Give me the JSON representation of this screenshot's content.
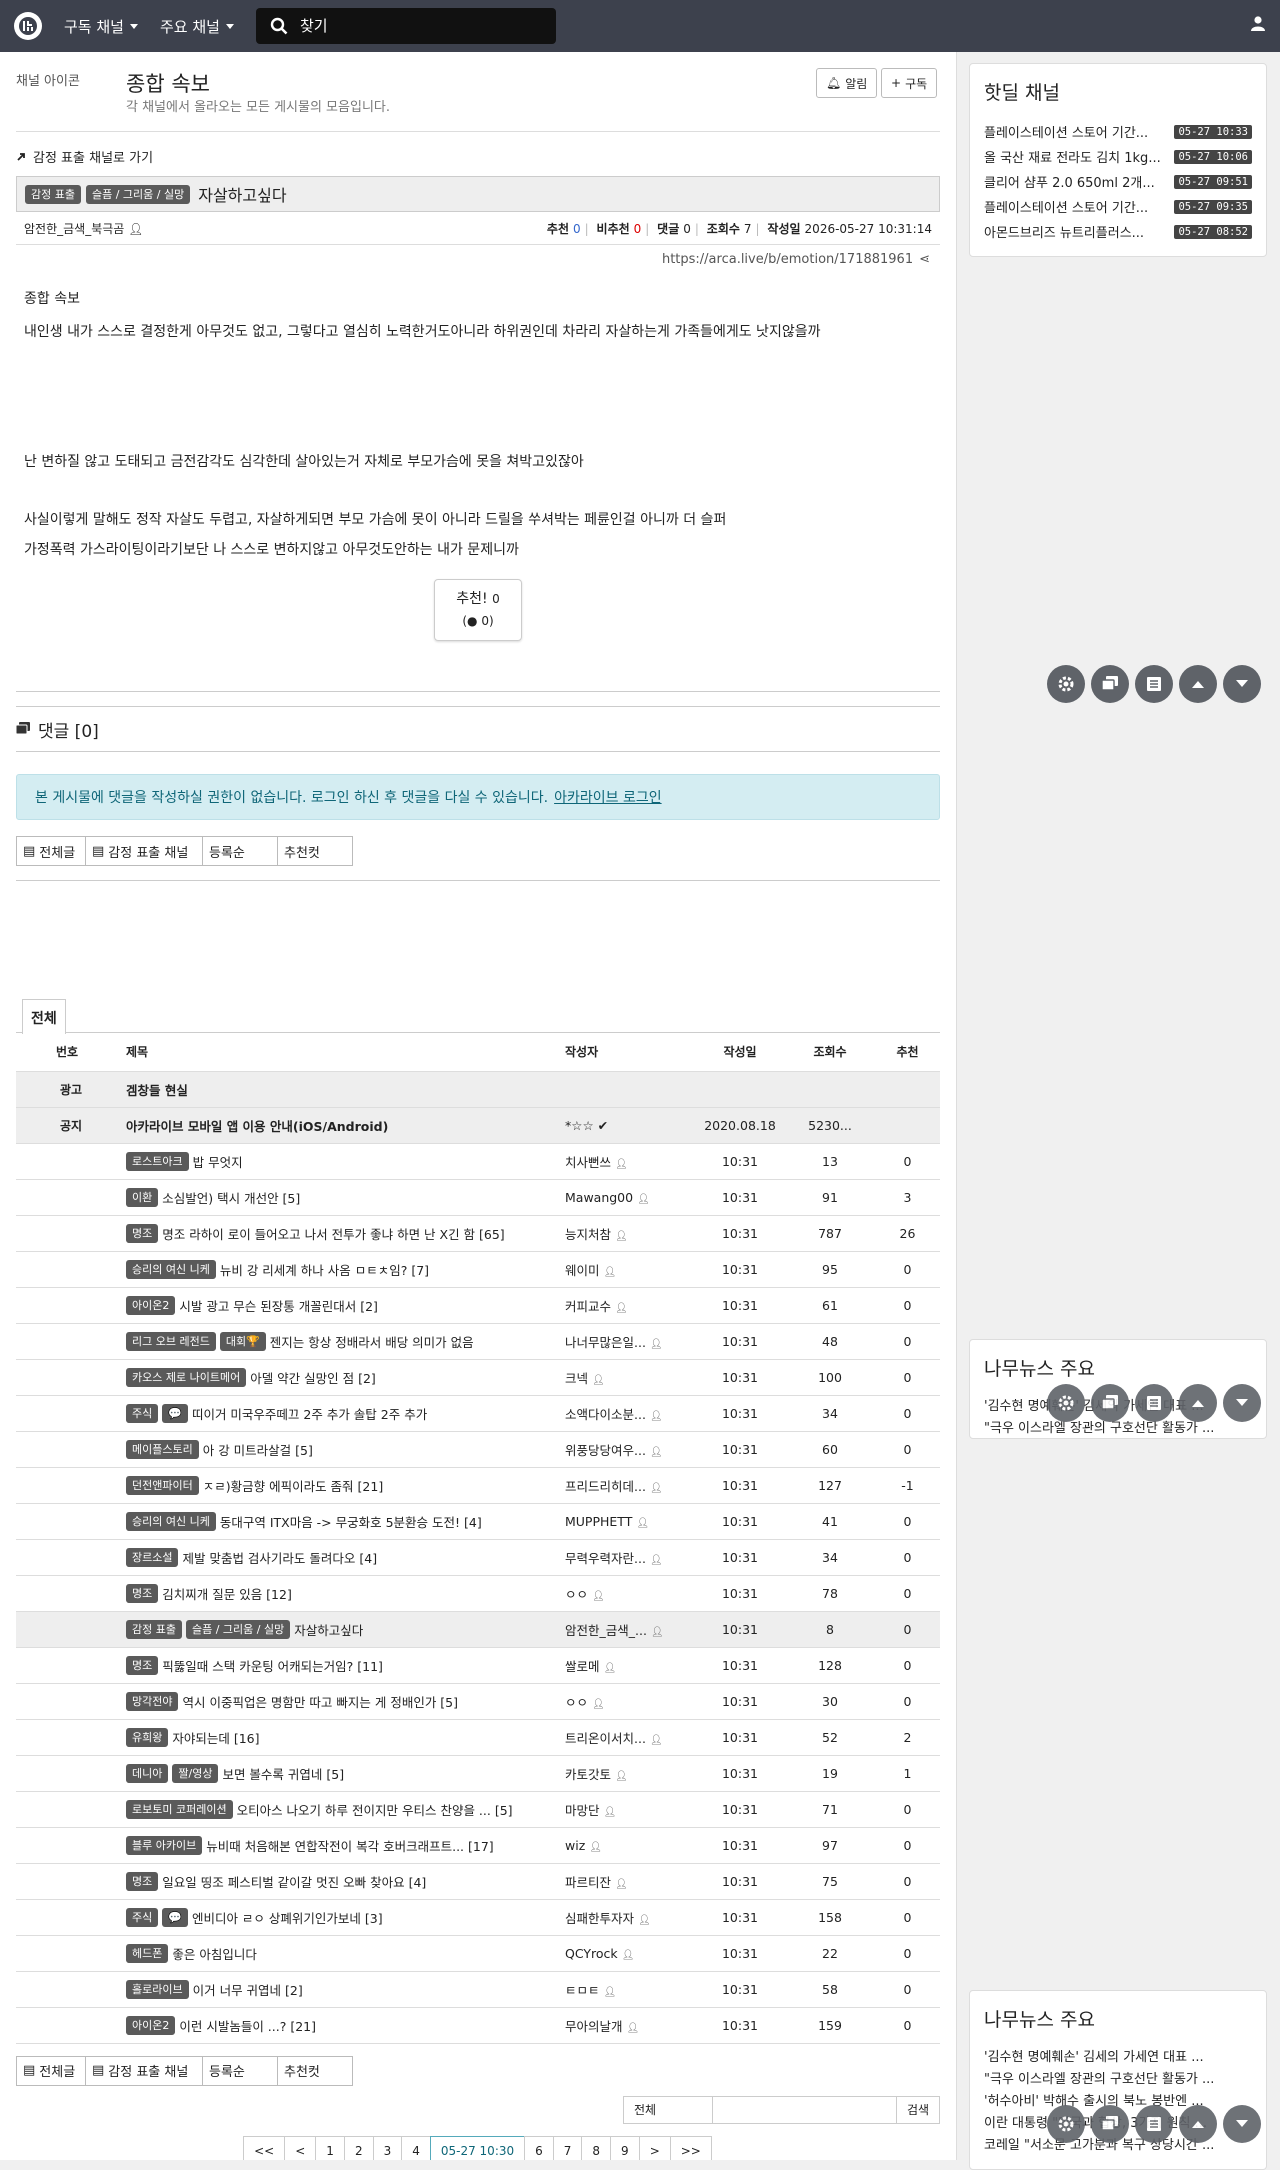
{
  "nav": {
    "menu1": "구독 채널",
    "menu2": "주요 채널",
    "search_placeholder": "찾기"
  },
  "channel": {
    "img_alt": "채널 아이콘",
    "title": "종합 속보",
    "desc": "각 채널에서 올라오는 모든 게시물의 모음입니다.",
    "alarm": "알림",
    "subscribe": "구독"
  },
  "article": {
    "goto": "감정 표출 채널로 가기",
    "badge1": "감정 표출",
    "badge2": "슬픔 / 그리움 / 실망",
    "title": "자살하고싶다",
    "author": "암전한_금색_북극곰",
    "rec_label": "추천",
    "rec": "0",
    "unrec_label": "비추천",
    "unrec": "0",
    "cmt_label": "댓글",
    "cmt": "0",
    "view_label": "조회수",
    "view": "7",
    "date_label": "작성일",
    "date": "2026-05-27 10:31:14",
    "url": "https://arca.live/b/emotion/171881961",
    "img_alt": "종합 속보",
    "p1": "내인생 내가 스스로 결정한게 아무것도 없고, 그렇다고 열심히 노력한거도아니라 하위권인데 차라리 자살하는게 가족들에게도 낫지않을까",
    "p2": "난 변하질 않고 도태되고 금전감각도 심각한데 살아있는거 자체로 부모가슴에 못을 쳐박고있잖아",
    "p3": "사실이렇게 말해도 정작 자살도 두렵고, 자살하게되면 부모 가슴에 못이 아니라 드릴을 쑤셔박는 페륜인걸 아니까 더 슬퍼",
    "p4": "가정폭력 가스라이팅이라기보단 나 스스로 변하지않고 아무것도안하는 내가 문제니까",
    "rec_btn": "추천!",
    "rec_btn_count": "0",
    "rec_btn_sub": "0"
  },
  "comments": {
    "title": "댓글 [0]",
    "alert": "본 게시물에 댓글을 작성하실 권한이 없습니다. 로그인 하신 후 댓글을 다실 수 있습니다.",
    "login_link": "아카라이브 로그인"
  },
  "tabs": [
    "전체글",
    "감정 표출 채널",
    "등록순",
    "추천컷"
  ],
  "list": {
    "tab": "전체",
    "headers": [
      "번호",
      "제목",
      "작성자",
      "작성일",
      "조회수",
      "추천"
    ],
    "ad": {
      "no": "광고",
      "title": "겜창들 현실"
    },
    "notice": {
      "no": "공지",
      "title": "아카라이브 모바일 앱 이용 안내(iOS/Android)",
      "author": "*☆☆",
      "date": "2020.08.18",
      "view": "5230..."
    },
    "rows": [
      {
        "b": [
          "로스트아크"
        ],
        "t": "밥 무엇지",
        "a": "치사뻔쓰",
        "d": "10:31",
        "v": "13",
        "r": "0"
      },
      {
        "b": [
          "이환"
        ],
        "t": "소심발언) 택시 개선안 [5]",
        "a": "Mawang00",
        "d": "10:31",
        "v": "91",
        "r": "3"
      },
      {
        "b": [
          "명조"
        ],
        "t": "명조 라하이 로이 들어오고 나서 전투가 좋냐 하면 난 X긴 함 [65]",
        "a": "능지처참",
        "d": "10:31",
        "v": "787",
        "r": "26"
      },
      {
        "b": [
          "승리의 여신 니케"
        ],
        "t": "뉴비 강 리세계 하나 사옴 ㅁㅌㅊ임? [7]",
        "a": "웨이미",
        "d": "10:31",
        "v": "95",
        "r": "0"
      },
      {
        "b": [
          "아이온2"
        ],
        "t": "시발 광고 무슨 된장통 개꼴린대서 [2]",
        "a": "커피교수",
        "d": "10:31",
        "v": "61",
        "r": "0"
      },
      {
        "b": [
          "리그 오브 레전드",
          "대회🏆"
        ],
        "t": "젠지는 항상 정배라서 배당 의미가 없음",
        "a": "나너무많은일...",
        "d": "10:31",
        "v": "48",
        "r": "0"
      },
      {
        "b": [
          "카오스 제로 나이트메어"
        ],
        "t": "아델 약간 실망인 점 [2]",
        "a": "크넥",
        "d": "10:31",
        "v": "100",
        "r": "0"
      },
      {
        "b": [
          "주식",
          "💬"
        ],
        "t": "띠이거 미국우주떼끄 2주 추가 솔탑 2주 추가",
        "a": "소액다이소분...",
        "d": "10:31",
        "v": "34",
        "r": "0"
      },
      {
        "b": [
          "메이플스토리"
        ],
        "t": "아 강 미트라살걸 [5]",
        "a": "위풍당당여우...",
        "d": "10:31",
        "v": "60",
        "r": "0"
      },
      {
        "b": [
          "던전앤파이터"
        ],
        "t": "ㅈㄹ)황금향 에픽이라도 좀줘 [21]",
        "a": "프리드리히데...",
        "d": "10:31",
        "v": "127",
        "r": "-1"
      },
      {
        "b": [
          "승리의 여신 니케"
        ],
        "t": "동대구역 ITX마음 -> 무궁화호 5분환승 도전! [4]",
        "a": "MUPPHETT",
        "d": "10:31",
        "v": "41",
        "r": "0"
      },
      {
        "b": [
          "장르소설"
        ],
        "t": "제발 맞춤법 검사기라도 돌려다오 [4]",
        "a": "무력우력자란...",
        "d": "10:31",
        "v": "34",
        "r": "0"
      },
      {
        "b": [
          "명조"
        ],
        "t": "김치찌개 질문 있음 [12]",
        "a": "ㅇㅇ",
        "d": "10:31",
        "v": "78",
        "r": "0"
      },
      {
        "b": [
          "감정 표출",
          "슬픔 / 그리움 / 실망"
        ],
        "t": "자살하고싶다",
        "a": "암전한_금색_...",
        "d": "10:31",
        "v": "8",
        "r": "0",
        "hl": true
      },
      {
        "b": [
          "명조"
        ],
        "t": "픽뚫일때 스택 카운팅 어캐되는거임? [11]",
        "a": "쌀로메",
        "d": "10:31",
        "v": "128",
        "r": "0"
      },
      {
        "b": [
          "망각전야"
        ],
        "t": "역시 이중픽업은 명함만 따고 빠지는 게 정배인가 [5]",
        "a": "ㅇㅇ",
        "d": "10:31",
        "v": "30",
        "r": "0"
      },
      {
        "b": [
          "유희왕"
        ],
        "t": "자야되는데 [16]",
        "a": "트리온이서치...",
        "d": "10:31",
        "v": "52",
        "r": "2"
      },
      {
        "b": [
          "데니아",
          "짤/영상"
        ],
        "t": "보면 볼수록 귀엽네 [5]",
        "a": "카토갓토",
        "d": "10:31",
        "v": "19",
        "r": "1"
      },
      {
        "b": [
          "로보토미 코퍼레이션"
        ],
        "t": "오티아스 나오기 하루 전이지만 우티스 찬양을 ... [5]",
        "a": "마망단",
        "d": "10:31",
        "v": "71",
        "r": "0"
      },
      {
        "b": [
          "블루 아카이브"
        ],
        "t": "뉴비때 처음해본 연합작전이 복각 호버크래프트... [17]",
        "a": "wiz",
        "d": "10:31",
        "v": "97",
        "r": "0"
      },
      {
        "b": [
          "명조"
        ],
        "t": "일요일 띵조 페스티벌 같이갈 멋진 오빠 찾아요 [4]",
        "a": "파르티잔",
        "d": "10:31",
        "v": "75",
        "r": "0"
      },
      {
        "b": [
          "주식",
          "💬"
        ],
        "t": "엔비디아 ㄹㅇ 상폐위기인가보네 [3]",
        "a": "심패한투자자",
        "d": "10:31",
        "v": "158",
        "r": "0"
      },
      {
        "b": [
          "헤드폰"
        ],
        "t": "좋은 아침입니다",
        "a": "QCYrock",
        "d": "10:31",
        "v": "22",
        "r": "0"
      },
      {
        "b": [
          "홀로라이브"
        ],
        "t": "이거 너무 귀엽네 [2]",
        "a": "ㅌㅁㅌ",
        "d": "10:31",
        "v": "58",
        "r": "0"
      },
      {
        "b": [
          "아이온2"
        ],
        "t": "이런 시발놈들이 ...? [21]",
        "a": "무아의날개",
        "d": "10:31",
        "v": "159",
        "r": "0"
      }
    ]
  },
  "search_bar": {
    "scope": "전체",
    "submit": "검색"
  },
  "pager": [
    "<<",
    "<",
    "1",
    "2",
    "3",
    "4",
    "05-27 10:30",
    "6",
    "7",
    "8",
    "9",
    ">",
    ">>"
  ],
  "sidebar": {
    "hotdeal_title": "핫딜 채널",
    "hotdeal": [
      {
        "n": "플레이스테이션 스토어 기간...",
        "t": "05-27 10:33"
      },
      {
        "n": "올 국산 재료 전라도 김치 1kg...",
        "t": "05-27 10:06"
      },
      {
        "n": "클리어 샴푸 2.0 650ml 2개...",
        "t": "05-27 09:51"
      },
      {
        "n": "플레이스테이션 스토어 기간...",
        "t": "05-27 09:35"
      },
      {
        "n": "아몬드브리즈 뉴트리플러스...",
        "t": "05-27 08:52"
      }
    ],
    "news1_title": "나무뉴스 주요",
    "news1": [
      "'김수현 명예훼손' 김세의 가세연 대표 ...",
      "\"극우 이스라엘 장관의 구호선단 활동가 ..."
    ],
    "news2_title": "나무뉴스 주요",
    "news2": [
      "'김수현 명예훼손' 김세의 가세연 대표 ...",
      "\"극우 이스라엘 장관의 구호선단 활동가 ...",
      "'허수아비' 박해수 출시의 북노 봉반엔 ...",
      "이란 대통령 \"미국과 협상, 3가지 원칙 ...",
      "코레일 \"서소문 고가분과 복구 상당시간 ..."
    ]
  }
}
